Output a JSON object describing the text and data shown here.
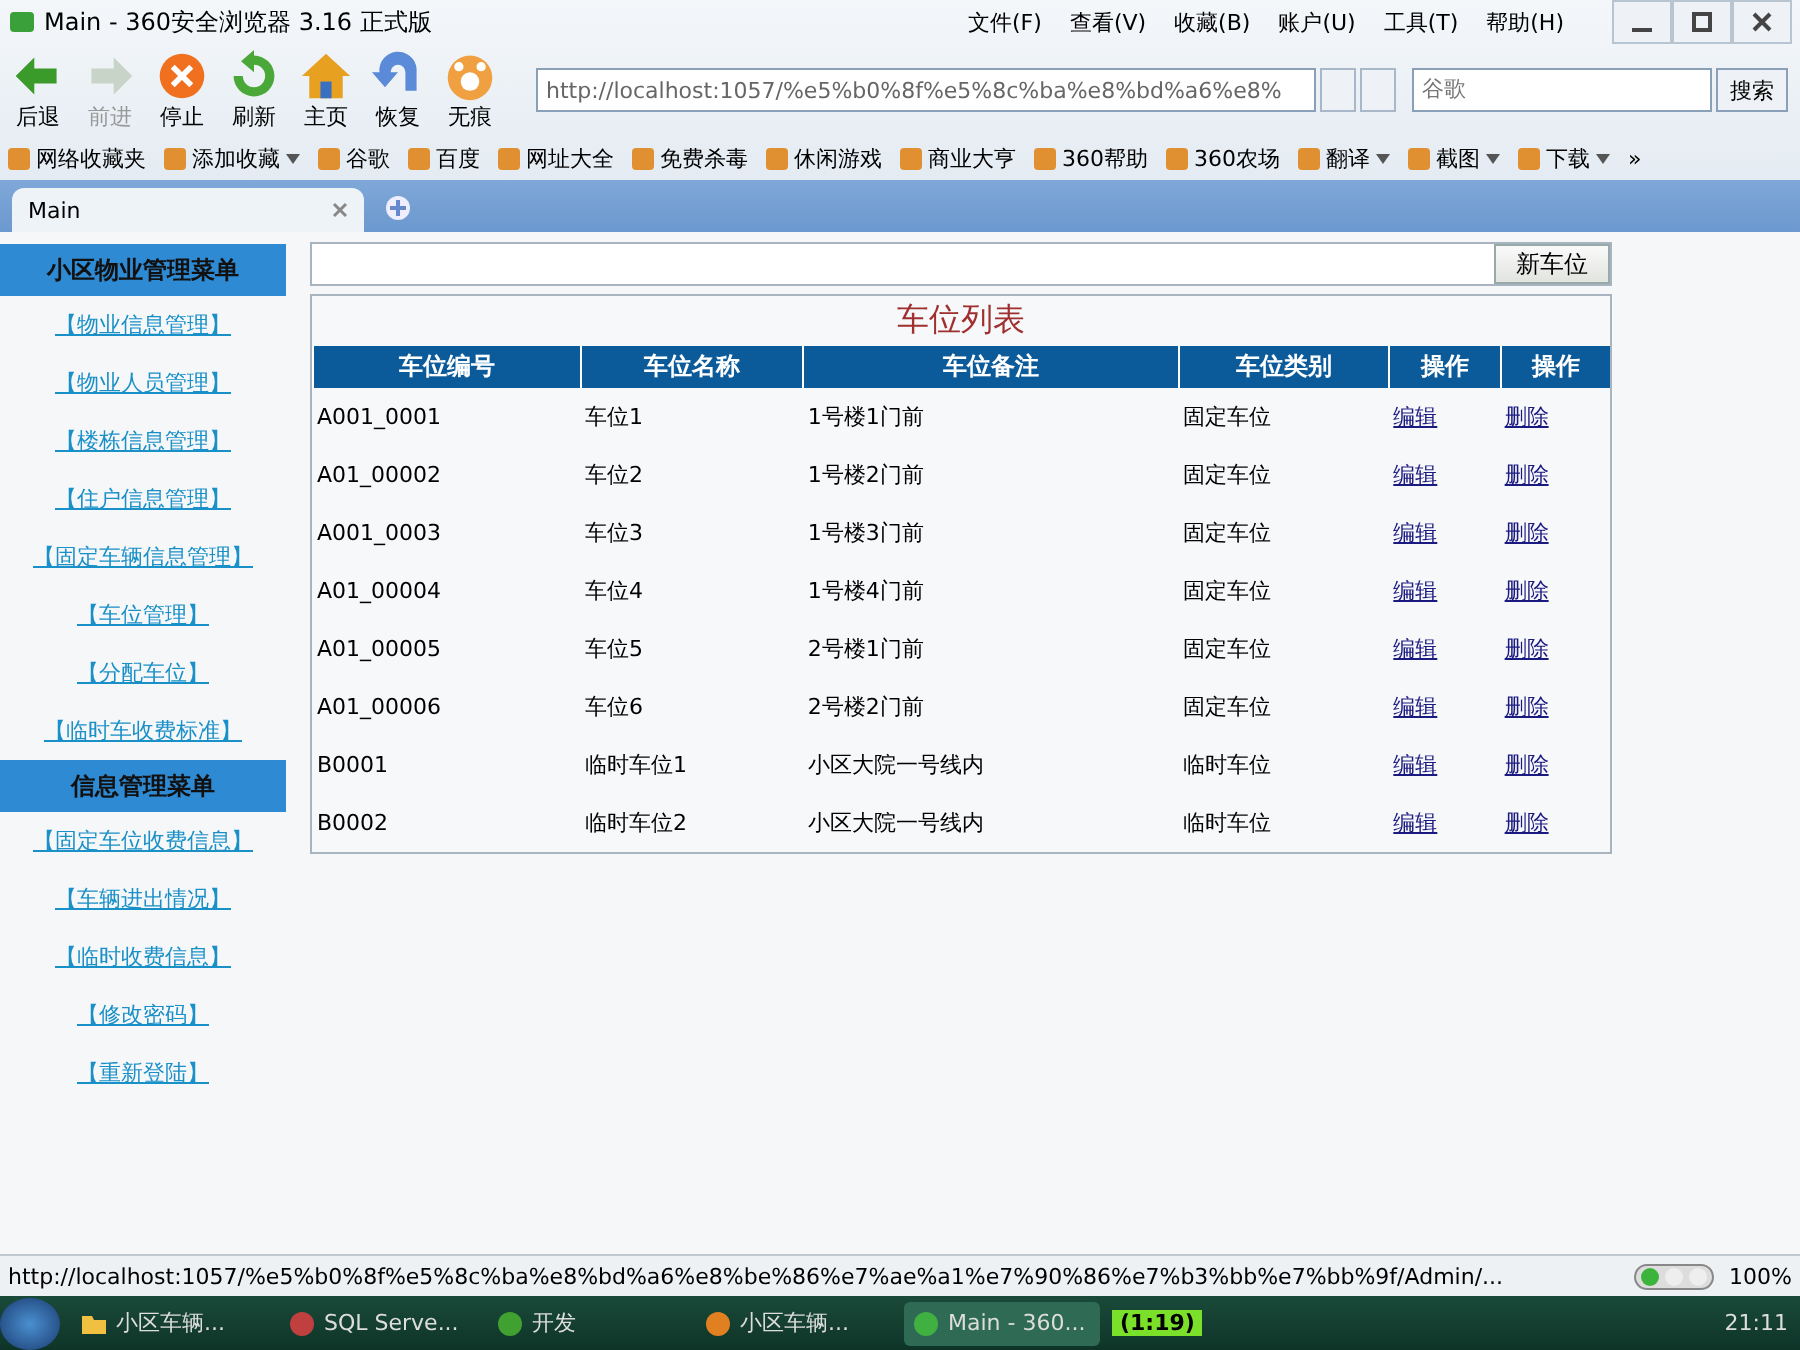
{
  "window": {
    "title": "Main - 360安全浏览器 3.16 正式版"
  },
  "menu": [
    "文件(F)",
    "查看(V)",
    "收藏(B)",
    "账户(U)",
    "工具(T)",
    "帮助(H)"
  ],
  "nav_buttons": [
    {
      "kind": "back",
      "label": "后退",
      "disabled": false
    },
    {
      "kind": "forward",
      "label": "前进",
      "disabled": true
    },
    {
      "kind": "stop",
      "label": "停止",
      "disabled": false
    },
    {
      "kind": "refresh",
      "label": "刷新",
      "disabled": false
    },
    {
      "kind": "home",
      "label": "主页",
      "disabled": false
    },
    {
      "kind": "restore",
      "label": "恢复",
      "disabled": false
    },
    {
      "kind": "private",
      "label": "无痕",
      "disabled": false
    }
  ],
  "address_bar": {
    "value": "http://localhost:1057/%e5%b0%8f%e5%8c%ba%e8%bd%a6%e8%"
  },
  "search": {
    "placeholder": "谷歌",
    "button": "搜索"
  },
  "bookmarks": [
    {
      "label": "网络收藏夹",
      "dropdown": false
    },
    {
      "label": "添加收藏",
      "dropdown": true
    },
    {
      "label": "谷歌",
      "dropdown": false
    },
    {
      "label": "百度",
      "dropdown": false
    },
    {
      "label": "网址大全",
      "dropdown": false
    },
    {
      "label": "免费杀毒",
      "dropdown": false
    },
    {
      "label": "休闲游戏",
      "dropdown": false
    },
    {
      "label": "商业大亨",
      "dropdown": false
    },
    {
      "label": "360帮助",
      "dropdown": false
    },
    {
      "label": "360农场",
      "dropdown": false
    },
    {
      "label": "翻译",
      "dropdown": true
    },
    {
      "label": "截图",
      "dropdown": true
    },
    {
      "label": "下载",
      "dropdown": true
    }
  ],
  "bookmarks_more": "»",
  "tabs": [
    {
      "label": "Main",
      "selected": true
    }
  ],
  "sidebar": {
    "sections": [
      {
        "title": "小区物业管理菜单",
        "items": [
          "【物业信息管理】",
          "【物业人员管理】",
          "【楼栋信息管理】",
          "【住户信息管理】",
          "【固定车辆信息管理】",
          "【车位管理】",
          "【分配车位】",
          "【临时车收费标准】"
        ]
      },
      {
        "title": "信息管理菜单",
        "items": [
          "【固定车位收费信息】",
          "【车辆进出情况】",
          "【临时收费信息】",
          "【修改密码】",
          "【重新登陆】"
        ]
      }
    ]
  },
  "toolbar": {
    "button": "新车位"
  },
  "table": {
    "title": "车位列表",
    "columns": [
      "车位编号",
      "车位名称",
      "车位备注",
      "车位类别",
      "操作",
      "操作"
    ],
    "rows": [
      [
        "A001_0001",
        "车位1",
        "1号楼1门前",
        "固定车位",
        "编辑",
        "删除"
      ],
      [
        "A01_00002",
        "车位2",
        "1号楼2门前",
        "固定车位",
        "编辑",
        "删除"
      ],
      [
        "A001_0003",
        "车位3",
        "1号楼3门前",
        "固定车位",
        "编辑",
        "删除"
      ],
      [
        "A01_00004",
        "车位4",
        "1号楼4门前",
        "固定车位",
        "编辑",
        "删除"
      ],
      [
        "A01_00005",
        "车位5",
        "2号楼1门前",
        "固定车位",
        "编辑",
        "删除"
      ],
      [
        "A01_00006",
        "车位6",
        "2号楼2门前",
        "固定车位",
        "编辑",
        "删除"
      ],
      [
        "B0001",
        "临时车位1",
        "小区大院一号线内",
        "临时车位",
        "编辑",
        "删除"
      ],
      [
        "B0002",
        "临时车位2",
        "小区大院一号线内",
        "临时车位",
        "编辑",
        "删除"
      ]
    ]
  },
  "status_bar": {
    "url": "http://localhost:1057/%e5%b0%8f%e5%8c%ba%e8%bd%a6%e8%be%86%e7%ae%a1%e7%90%86%e7%b3%bb%e7%bb%9f/Admin/...",
    "zoom": "100%"
  },
  "taskbar": {
    "items": [
      {
        "label": "小区车辆...",
        "kind": "folder",
        "selected": false
      },
      {
        "label": "SQL Serve...",
        "kind": "sql",
        "selected": false
      },
      {
        "label": "开发",
        "kind": "tree",
        "selected": false
      },
      {
        "label": "小区车辆...",
        "kind": "app",
        "selected": false
      },
      {
        "label": "Main - 360...",
        "kind": "browser",
        "selected": true
      }
    ],
    "timer": "(1:19)",
    "clock": "21:11"
  }
}
